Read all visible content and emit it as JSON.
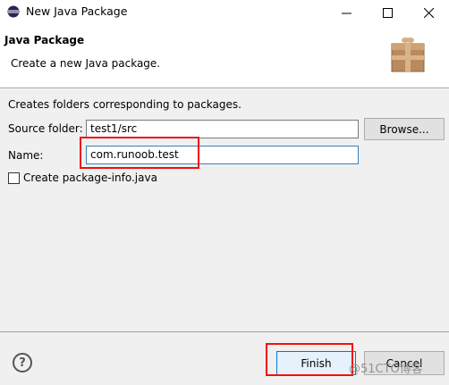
{
  "window": {
    "title": "New Java Package"
  },
  "header": {
    "title": "Java Package",
    "description": "Create a new Java package."
  },
  "body": {
    "info": "Creates folders corresponding to packages.",
    "source_folder": {
      "label": "Source folder:",
      "value": "test1/src",
      "browse_label": "Browse..."
    },
    "name": {
      "label": "Name:",
      "value": "com.runoob.test"
    },
    "create_package_info": {
      "label": "Create package-info.java",
      "checked": false
    }
  },
  "footer": {
    "help_glyph": "?",
    "finish_label": "Finish",
    "cancel_label": "Cancel"
  },
  "watermark": "@51CTO博客",
  "colors": {
    "highlight": "#ee1111",
    "focus_border": "#0078d7",
    "icon_blue": "#2b4a8a",
    "package_brown": "#b98a5e"
  },
  "icons": [
    "eclipse-icon",
    "minimize-icon",
    "maximize-icon",
    "close-icon",
    "package-wizard-icon",
    "help-icon"
  ]
}
